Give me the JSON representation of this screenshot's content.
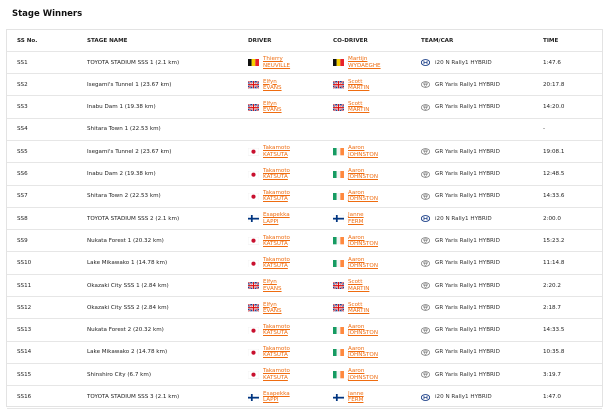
{
  "page": {
    "title": "Stage Winners"
  },
  "headers": {
    "stage": "SS No.",
    "name": "STAGE NAME",
    "driver": "DRIVER",
    "codriver": "CO-DRIVER",
    "team": "TEAM/CAR",
    "time": "TIME"
  },
  "colors": {
    "link": "#ef6c10",
    "border": "#e6e6e6"
  },
  "rows": [
    {
      "stage": "SS1",
      "name": "TOYOTA STADIUM SSS 1 (2.1 km)",
      "driver_first": "Thierry",
      "driver_last": "NEUVILLE",
      "driver_flag": "belgium-flag-icon",
      "codriver_first": "Martijn",
      "codriver_last": "WYDAEGHE",
      "codriver_flag": "belgium-flag-icon",
      "team": "i20 N Rally1 HYBRID",
      "team_logo": "hyundai-logo-icon",
      "time": "1:47.6"
    },
    {
      "stage": "SS2",
      "name": "Isegami's Tunnel 1 (23.67 km)",
      "driver_first": "Elfyn",
      "driver_last": "EVANS",
      "driver_flag": "uk-flag-icon",
      "codriver_first": "Scott",
      "codriver_last": "MARTIN",
      "codriver_flag": "uk-flag-icon",
      "team": "GR Yaris Rally1 HYBRID",
      "team_logo": "toyota-logo-icon",
      "time": "20:17.8"
    },
    {
      "stage": "SS3",
      "name": "Inabu Dam 1 (19.38 km)",
      "driver_first": "Elfyn",
      "driver_last": "EVANS",
      "driver_flag": "uk-flag-icon",
      "codriver_first": "Scott",
      "codriver_last": "MARTIN",
      "codriver_flag": "uk-flag-icon",
      "team": "GR Yaris Rally1 HYBRID",
      "team_logo": "toyota-logo-icon",
      "time": "14:20.0"
    },
    {
      "stage": "SS4",
      "name": "Shitara Town 1 (22.53 km)",
      "driver_first": "",
      "driver_last": "",
      "driver_flag": "",
      "codriver_first": "",
      "codriver_last": "",
      "codriver_flag": "",
      "team": "",
      "team_logo": "",
      "time": "-"
    },
    {
      "stage": "SS5",
      "name": "Isegami's Tunnel 2 (23.67 km)",
      "driver_first": "Takamoto",
      "driver_last": "KATSUTA",
      "driver_flag": "japan-flag-icon",
      "codriver_first": "Aaron",
      "codriver_last": "JOHNSTON",
      "codriver_flag": "ireland-flag-icon",
      "team": "GR Yaris Rally1 HYBRID",
      "team_logo": "toyota-logo-icon",
      "time": "19:08.1"
    },
    {
      "stage": "SS6",
      "name": "Inabu Dam 2 (19.38 km)",
      "driver_first": "Takamoto",
      "driver_last": "KATSUTA",
      "driver_flag": "japan-flag-icon",
      "codriver_first": "Aaron",
      "codriver_last": "JOHNSTON",
      "codriver_flag": "ireland-flag-icon",
      "team": "GR Yaris Rally1 HYBRID",
      "team_logo": "toyota-logo-icon",
      "time": "12:48.5"
    },
    {
      "stage": "SS7",
      "name": "Shitara Town 2 (22.53 km)",
      "driver_first": "Takamoto",
      "driver_last": "KATSUTA",
      "driver_flag": "japan-flag-icon",
      "codriver_first": "Aaron",
      "codriver_last": "JOHNSTON",
      "codriver_flag": "ireland-flag-icon",
      "team": "GR Yaris Rally1 HYBRID",
      "team_logo": "toyota-logo-icon",
      "time": "14:33.6"
    },
    {
      "stage": "SS8",
      "name": "TOYOTA STADIUM SSS 2 (2.1 km)",
      "driver_first": "Esapekka",
      "driver_last": "LAPPI",
      "driver_flag": "finland-flag-icon",
      "codriver_first": "Janne",
      "codriver_last": "FERM",
      "codriver_flag": "finland-flag-icon",
      "team": "i20 N Rally1 HYBRID",
      "team_logo": "hyundai-logo-icon",
      "time": "2:00.0"
    },
    {
      "stage": "SS9",
      "name": "Nukata Forest 1 (20.32 km)",
      "driver_first": "Takamoto",
      "driver_last": "KATSUTA",
      "driver_flag": "japan-flag-icon",
      "codriver_first": "Aaron",
      "codriver_last": "JOHNSTON",
      "codriver_flag": "ireland-flag-icon",
      "team": "GR Yaris Rally1 HYBRID",
      "team_logo": "toyota-logo-icon",
      "time": "15:23.2"
    },
    {
      "stage": "SS10",
      "name": "Lake Mikawako 1 (14.78 km)",
      "driver_first": "Takamoto",
      "driver_last": "KATSUTA",
      "driver_flag": "japan-flag-icon",
      "codriver_first": "Aaron",
      "codriver_last": "JOHNSTON",
      "codriver_flag": "ireland-flag-icon",
      "team": "GR Yaris Rally1 HYBRID",
      "team_logo": "toyota-logo-icon",
      "time": "11:14.8"
    },
    {
      "stage": "SS11",
      "name": "Okazaki City SSS 1 (2.84 km)",
      "driver_first": "Elfyn",
      "driver_last": "EVANS",
      "driver_flag": "uk-flag-icon",
      "codriver_first": "Scott",
      "codriver_last": "MARTIN",
      "codriver_flag": "uk-flag-icon",
      "team": "GR Yaris Rally1 HYBRID",
      "team_logo": "toyota-logo-icon",
      "time": "2:20.2"
    },
    {
      "stage": "SS12",
      "name": "Okazaki City SSS 2 (2.84 km)",
      "driver_first": "Elfyn",
      "driver_last": "EVANS",
      "driver_flag": "uk-flag-icon",
      "codriver_first": "Scott",
      "codriver_last": "MARTIN",
      "codriver_flag": "uk-flag-icon",
      "team": "GR Yaris Rally1 HYBRID",
      "team_logo": "toyota-logo-icon",
      "time": "2:18.7"
    },
    {
      "stage": "SS13",
      "name": "Nukata Forest 2 (20.32 km)",
      "driver_first": "Takamoto",
      "driver_last": "KATSUTA",
      "driver_flag": "japan-flag-icon",
      "codriver_first": "Aaron",
      "codriver_last": "JOHNSTON",
      "codriver_flag": "ireland-flag-icon",
      "team": "GR Yaris Rally1 HYBRID",
      "team_logo": "toyota-logo-icon",
      "time": "14:33.5"
    },
    {
      "stage": "SS14",
      "name": "Lake Mikawako 2 (14.78 km)",
      "driver_first": "Takamoto",
      "driver_last": "KATSUTA",
      "driver_flag": "japan-flag-icon",
      "codriver_first": "Aaron",
      "codriver_last": "JOHNSTON",
      "codriver_flag": "ireland-flag-icon",
      "team": "GR Yaris Rally1 HYBRID",
      "team_logo": "toyota-logo-icon",
      "time": "10:35.8"
    },
    {
      "stage": "SS15",
      "name": "Shinshiro City (6.7 km)",
      "driver_first": "Takamoto",
      "driver_last": "KATSUTA",
      "driver_flag": "japan-flag-icon",
      "codriver_first": "Aaron",
      "codriver_last": "JOHNSTON",
      "codriver_flag": "ireland-flag-icon",
      "team": "GR Yaris Rally1 HYBRID",
      "team_logo": "toyota-logo-icon",
      "time": "3:19.7"
    },
    {
      "stage": "SS16",
      "name": "TOYOTA STADIUM SSS 3 (2.1 km)",
      "driver_first": "Esapekka",
      "driver_last": "LAPPI",
      "driver_flag": "finland-flag-icon",
      "codriver_first": "Janne",
      "codriver_last": "FERM",
      "codriver_flag": "finland-flag-icon",
      "team": "i20 N Rally1 HYBRID",
      "team_logo": "hyundai-logo-icon",
      "time": "1:47.0"
    }
  ]
}
